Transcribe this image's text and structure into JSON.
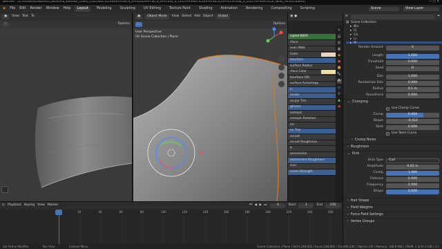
{
  "window": {
    "title": "Blender* [D:\\HONGS\\ANDHOO_work\\#8_Blender_Class_COLOSOC\\CLASS\\PHYSICS_APPLIED\\PHYSICS_APPLIED_3_CLOTH+PARTICLE\\PHYSICS_APPLICATION_3_CLOTH+PARTICLE_NEW_record.blend]"
  },
  "menubar": {
    "menus": [
      "File",
      "Edit",
      "Render",
      "Window",
      "Help"
    ],
    "workspaces": [
      "Layout",
      "Modeling",
      "Sculpting",
      "UV Editing",
      "Texture Paint",
      "Shading",
      "Animation",
      "Rendering",
      "Compositing",
      "Scripting"
    ],
    "active_workspace": "Layout",
    "scene": "Scene",
    "view_layer": "View Layer"
  },
  "left_viewport": {
    "header": [
      "View",
      "Text",
      "Te"
    ]
  },
  "main_viewport": {
    "mode": "Object Mode",
    "menus": [
      "View",
      "Select",
      "Add",
      "Object"
    ],
    "orientation": "Global",
    "options": "Options",
    "overlay_line1": "User Perspective",
    "overlay_line2": "(0) Scene Collection | Plane"
  },
  "left_options": "Options",
  "material_panel": {
    "header": "cipled BSDF",
    "items": [
      {
        "label": "rface",
        "style": "plain"
      },
      {
        "label": "ssen Walk",
        "style": "plain"
      },
      {
        "label": "Color",
        "style": "swatch"
      },
      {
        "label": "bsurface",
        "style": "blue"
      },
      {
        "label": "surface Radius",
        "style": "plain"
      },
      {
        "label": "rface Color",
        "style": "swatch"
      },
      {
        "label": "bsurface IOR",
        "style": "plain"
      },
      {
        "label": "surface Anisotropy",
        "style": "plain"
      },
      {
        "label": "ic",
        "style": "blue"
      },
      {
        "label": "ecular",
        "style": "blue"
      },
      {
        "label": "ecular Tint",
        "style": "plain"
      },
      {
        "label": "ghness",
        "style": "blue"
      },
      {
        "label": "sotropic",
        "style": "plain"
      },
      {
        "label": "sotropic Rotation",
        "style": "plain"
      },
      {
        "label": "en",
        "style": "plain"
      },
      {
        "label": "en Tint",
        "style": "blue"
      },
      {
        "label": "arcoat",
        "style": "plain"
      },
      {
        "label": "arcoat Roughness",
        "style": "plain"
      },
      {
        "label": "R",
        "style": "plain"
      },
      {
        "label": "ansmission",
        "style": "plain"
      },
      {
        "label": "ansmission Roughness",
        "style": "blue"
      },
      {
        "label": "sion",
        "style": "plain"
      },
      {
        "label": "ission Strength",
        "style": "blue"
      }
    ]
  },
  "outliner": {
    "items": [
      "Scene Collection",
      "Bin",
      "Cl",
      "Ca",
      "Li",
      "Pl"
    ]
  },
  "properties": {
    "render_amount": {
      "label": "Render Amount",
      "value": "2"
    },
    "fields_top": [
      {
        "label": "Length",
        "value": "1.000",
        "style": "blue"
      },
      {
        "label": "Threshold",
        "value": "0.000",
        "style": "plain"
      },
      {
        "label": "Seed",
        "value": "0",
        "style": "plain"
      }
    ],
    "fields_mid": [
      {
        "label": "Size",
        "value": "1.000",
        "style": "plain"
      },
      {
        "label": "Randomize Size",
        "value": "0.000",
        "style": "plain"
      },
      {
        "label": "Radius",
        "value": "0.1 m",
        "style": "plain"
      },
      {
        "label": "Roundness",
        "value": "0.000",
        "style": "plain"
      }
    ],
    "clumping": {
      "title": "Clumping",
      "use_curve": "Use Clump Curve",
      "fields": [
        {
          "label": "Clump",
          "value": "0.404",
          "fill": 0.7
        },
        {
          "label": "Shape",
          "value": "-0.422",
          "fill": 0.0
        },
        {
          "label": "Twist",
          "value": "0.000",
          "fill": 0.0
        }
      ],
      "use_noise": "Use Twist Curve"
    },
    "clump_noise": "Clump Noise",
    "roughness": "Roughness",
    "kink": {
      "title": "Kink",
      "kink_type_label": "Kink Type",
      "kink_type_value": "Curl",
      "fields": [
        {
          "label": "Amplitude",
          "value": "0.02 m",
          "style": "plain"
        },
        {
          "label": "Clump",
          "value": "1.000",
          "style": "blue"
        },
        {
          "label": "Flatness",
          "value": "0.000",
          "style": "plain"
        },
        {
          "label": "Frequency",
          "value": "2.000",
          "style": "plain"
        },
        {
          "label": "Shape",
          "value": "0.000",
          "style": "blue"
        }
      ]
    },
    "sections_bottom": [
      "Hair Shape",
      "Field Weights",
      "Force Field Settings",
      "Vertex Groups"
    ]
  },
  "timeline": {
    "menus": [
      "Playback",
      "Keying",
      "View",
      "Marker"
    ],
    "current_frame": "0",
    "start_label": "Start",
    "start": "1",
    "end_label": "End",
    "end": "250",
    "ticks": [
      "0",
      "20",
      "40",
      "60",
      "80",
      "100",
      "120",
      "140",
      "160",
      "180",
      "200",
      "220",
      "240",
      "260"
    ]
  },
  "statusbar": {
    "left": [
      "Set Active Modifier",
      "Pan View",
      "Context Menu"
    ],
    "right": "Scene Collection | Plane | Verts:249,602 | Faces:248,600 | Tris:496,200 | Objects:1/6 | Memory: 168.8 MiB | VRAM: 2.3/24.0 GiB | 3.1"
  }
}
